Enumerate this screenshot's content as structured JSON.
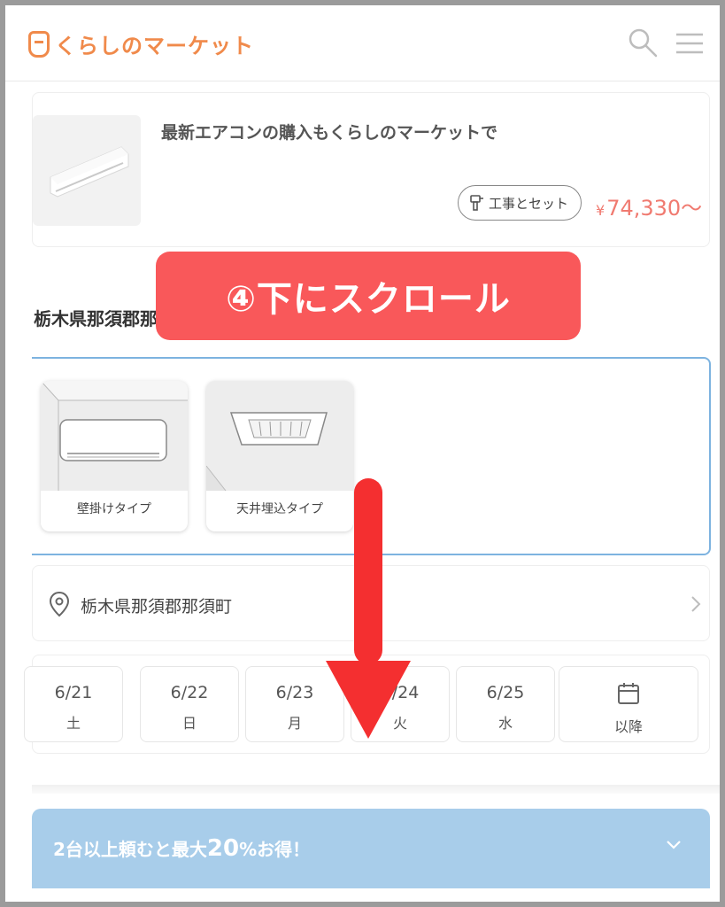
{
  "header": {
    "logo_text": "くらしのマーケット"
  },
  "product": {
    "title": "最新エアコンの購入もくらしのマーケットで",
    "set_label": "工事とセット",
    "price_currency": "¥",
    "price": "74,330～"
  },
  "region": {
    "title": "栃木県那須郡那"
  },
  "types": [
    {
      "label": "壁掛けタイプ"
    },
    {
      "label": "天井埋込タイプ"
    }
  ],
  "location": {
    "text": "栃木県那須郡那須町"
  },
  "dates": [
    {
      "day": "6/21",
      "dow": "土"
    },
    {
      "day": "6/22",
      "dow": "日"
    },
    {
      "day": "6/23",
      "dow": "月"
    },
    {
      "day": "6/24",
      "dow": "火"
    },
    {
      "day": "6/25",
      "dow": "水"
    }
  ],
  "date_later_label": "以降",
  "discount": {
    "prefix": "2台以上頼むと最大",
    "number": "20",
    "suffix": "%お得！"
  },
  "overlay": {
    "instruction": "④下にスクロール"
  },
  "colors": {
    "brand": "#f08a4b",
    "price": "#f07a70",
    "accent_blue": "#7db3e0",
    "banner": "#a8cdea",
    "instruction": "#f9585a",
    "arrow": "#f42f30"
  },
  "icons": [
    "search-icon",
    "menu-icon",
    "wrench-icon",
    "location-pin-icon",
    "chevron-right-icon",
    "calendar-icon",
    "chevron-down-icon",
    "down-arrow-icon"
  ]
}
